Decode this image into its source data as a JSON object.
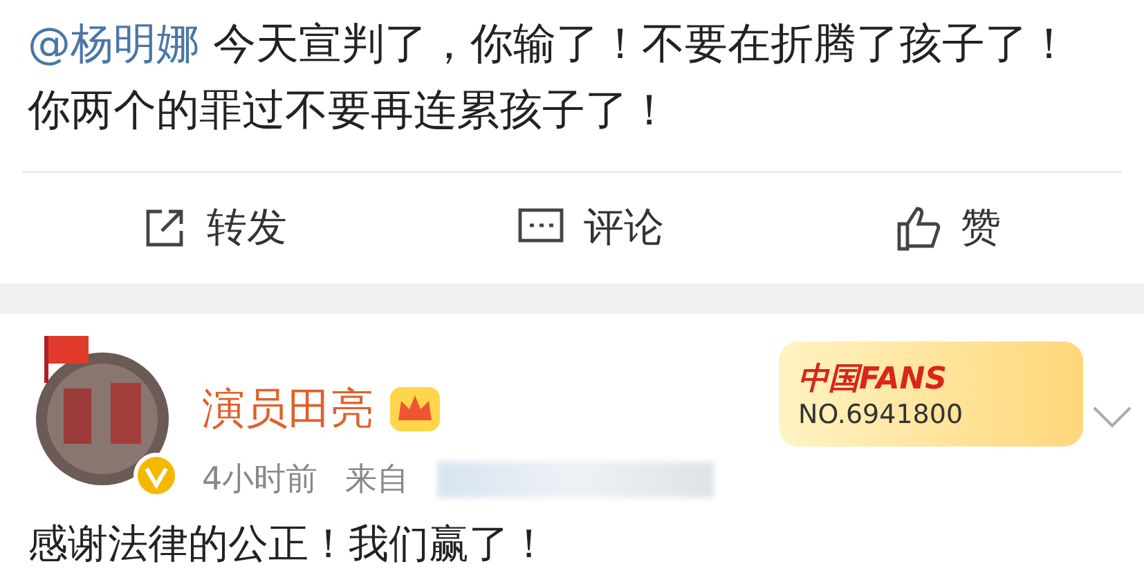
{
  "post": {
    "mention": "@杨明娜",
    "text": "今天宣判了，你输了！不要在折腾了孩子了！你两个的罪过不要再连累孩子了！"
  },
  "actions": [
    {
      "kind": "repost",
      "label": "转发"
    },
    {
      "kind": "comment",
      "label": "评论"
    },
    {
      "kind": "like",
      "label": "赞"
    }
  ],
  "reply": {
    "author": "演员田亮",
    "verified": true,
    "time": "4小时前",
    "source": "来自",
    "fan_badge": {
      "title": "中国FANS",
      "number": "NO.6941800"
    },
    "text": "感谢法律的公正！我们赢了！"
  }
}
